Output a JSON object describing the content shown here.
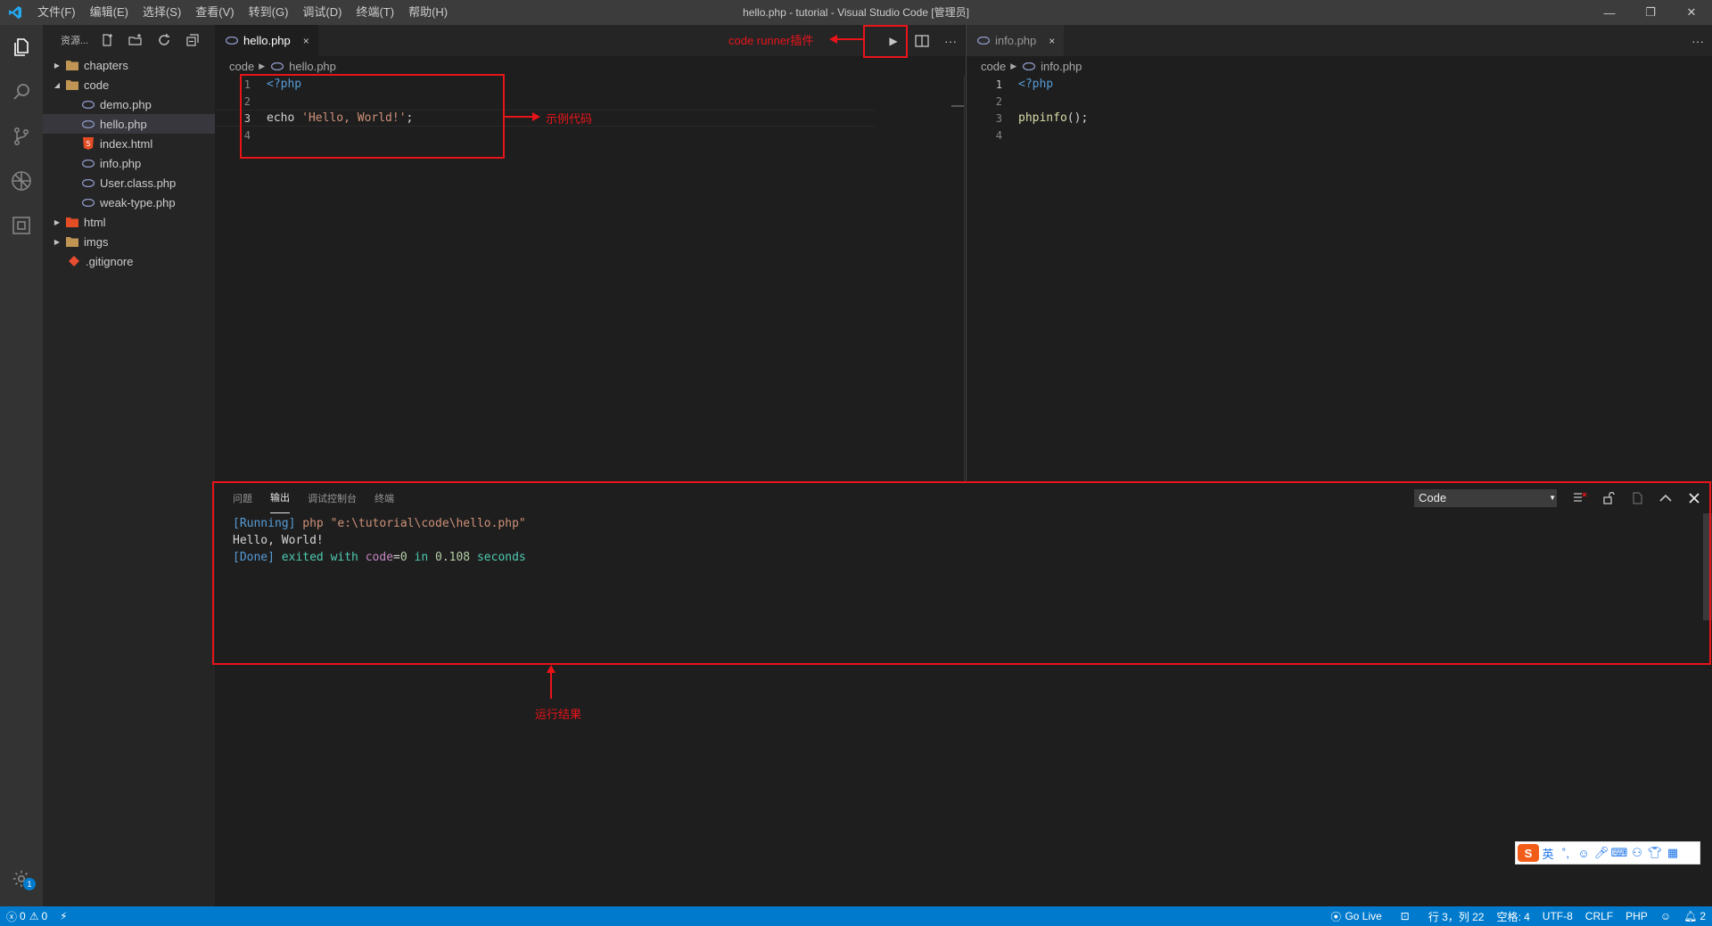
{
  "window": {
    "title": "hello.php - tutorial - Visual Studio Code [管理员]",
    "menu": [
      "文件(F)",
      "编辑(E)",
      "选择(S)",
      "查看(V)",
      "转到(G)",
      "调试(D)",
      "终端(T)",
      "帮助(H)"
    ],
    "minimize": "—",
    "restore": "❐",
    "close": "✕"
  },
  "activity_bar": {
    "icons": [
      "files-icon",
      "search-icon",
      "source-control-icon",
      "debug-icon",
      "extensions-icon"
    ],
    "settings_badge": "1"
  },
  "sidebar": {
    "title": "资源...",
    "items": [
      {
        "label": "chapters",
        "type": "folder",
        "expanded": false,
        "depth": 0
      },
      {
        "label": "code",
        "type": "folder",
        "expanded": true,
        "depth": 0
      },
      {
        "label": "demo.php",
        "type": "php",
        "depth": 1
      },
      {
        "label": "hello.php",
        "type": "php",
        "depth": 1,
        "selected": true
      },
      {
        "label": "index.html",
        "type": "html",
        "depth": 1
      },
      {
        "label": "info.php",
        "type": "php",
        "depth": 1
      },
      {
        "label": "User.class.php",
        "type": "php",
        "depth": 1
      },
      {
        "label": "weak-type.php",
        "type": "php",
        "depth": 1
      },
      {
        "label": "html",
        "type": "folder-html",
        "expanded": false,
        "depth": 0
      },
      {
        "label": "imgs",
        "type": "folder",
        "expanded": false,
        "depth": 0
      },
      {
        "label": ".gitignore",
        "type": "git",
        "depth": 0
      }
    ]
  },
  "editor1": {
    "tab": {
      "label": "hello.php",
      "close": "×"
    },
    "breadcrumb": {
      "folder": "code",
      "file": "hello.php"
    },
    "lines": [
      {
        "n": "1",
        "code": "<?php",
        "kind": "kw"
      },
      {
        "n": "2",
        "code": "",
        "kind": "plain"
      },
      {
        "n": "3",
        "code_a": "echo ",
        "code_b": "'Hello, World!'",
        "code_c": ";",
        "kind": "echo"
      },
      {
        "n": "4",
        "code": "",
        "kind": "plain"
      }
    ],
    "actions": {
      "run": "▶",
      "split": "split-editor-icon",
      "more": "···"
    }
  },
  "editor2": {
    "tab": {
      "label": "info.php",
      "close": "×"
    },
    "breadcrumb": {
      "folder": "code",
      "file": "info.php"
    },
    "lines": [
      {
        "n": "1",
        "code": "<?php",
        "kind": "kw"
      },
      {
        "n": "2",
        "code": "",
        "kind": "plain"
      },
      {
        "n": "3",
        "code_a": "phpinfo",
        "code_b": "();",
        "kind": "fn"
      },
      {
        "n": "4",
        "code": "",
        "kind": "plain"
      }
    ],
    "more": "···"
  },
  "panel": {
    "tabs": [
      "问题",
      "输出",
      "调试控制台",
      "终端"
    ],
    "active_tab": "输出",
    "channel": "Code",
    "output": {
      "line1_tag": "[Running]",
      "line1_rest": " php \"e:\\tutorial\\code\\hello.php\"",
      "line2": "Hello, World!",
      "line3_tag": "[Done]",
      "line3_a": " exited with ",
      "line3_b": "code",
      "line3_c": "=",
      "line3_d": "0",
      "line3_e": " in ",
      "line3_f": "0.108",
      "line3_g": " seconds"
    }
  },
  "annotations": {
    "code_runner": "code runner插件",
    "sample_code": "示例代码",
    "run_result": "运行结果",
    "color": "#e8141a"
  },
  "status_bar": {
    "errors": "0",
    "warnings": "0",
    "go_live": "Go Live",
    "position": "行 3，列 22",
    "spaces": "空格: 4",
    "encoding": "UTF-8",
    "eol": "CRLF",
    "language": "PHP",
    "notifications": "2",
    "color": "#007acc"
  },
  "ime": {
    "logo": "S",
    "lang": "英"
  }
}
